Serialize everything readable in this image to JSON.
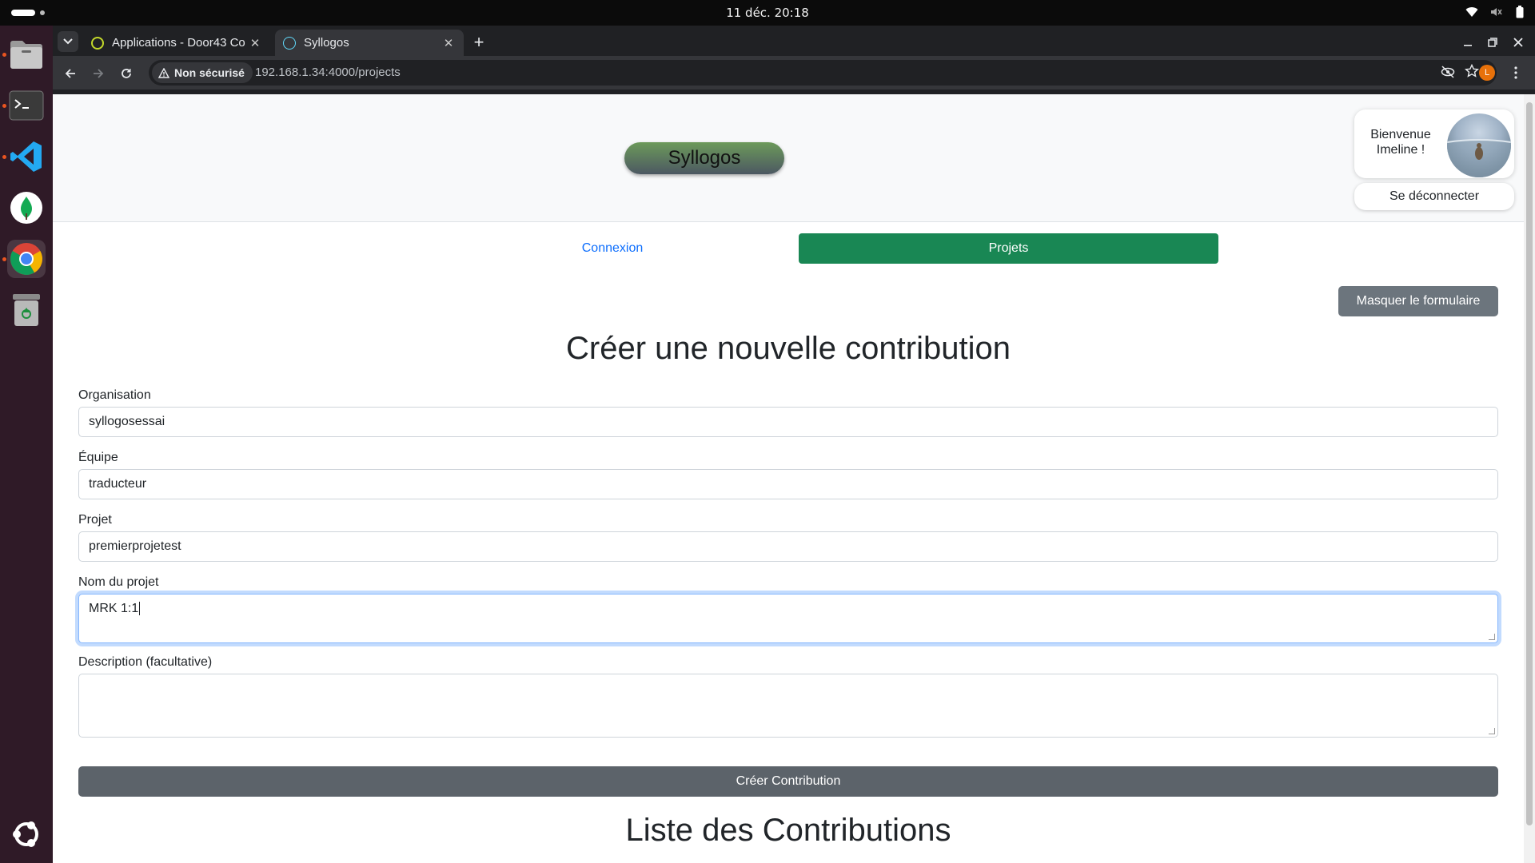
{
  "system": {
    "clock": "11 déc.  20:18"
  },
  "dock": {
    "apps": [
      "files-icon",
      "terminal-icon",
      "vscode-icon",
      "mongodb-compass-icon",
      "chrome-icon",
      "trash-icon",
      "ubuntu-apps-icon"
    ]
  },
  "browser": {
    "tabs": [
      {
        "title": "Applications - Door43 Co",
        "active": false
      },
      {
        "title": "Syllogos",
        "active": true
      }
    ],
    "security_label": "Non sécurisé",
    "url": "192.168.1.34:4000/projects",
    "profile_initial": "L"
  },
  "header": {
    "brand": "Syllogos",
    "welcome_line1": "Bienvenue",
    "welcome_line2": "Imeline !",
    "logout_label": "Se déconnecter"
  },
  "nav": {
    "login_label": "Connexion",
    "projects_label": "Projets"
  },
  "form": {
    "toggle_label": "Masquer le formulaire",
    "title": "Créer une nouvelle contribution",
    "fields": [
      {
        "label": "Organisation",
        "value": "syllogosessai"
      },
      {
        "label": "Équipe",
        "value": "traducteur"
      },
      {
        "label": "Projet",
        "value": "premierprojetest"
      },
      {
        "label": "Nom du projet",
        "value": "MRK 1:1"
      },
      {
        "label": "Description (facultative)",
        "value": ""
      }
    ],
    "submit_label": "Créer Contribution"
  },
  "list": {
    "title": "Liste des Contributions"
  },
  "colors": {
    "accent_green": "#198754",
    "link_blue": "#0d6efd",
    "secondary_gray": "#6c757d",
    "ubuntu_orange": "#e95420"
  }
}
